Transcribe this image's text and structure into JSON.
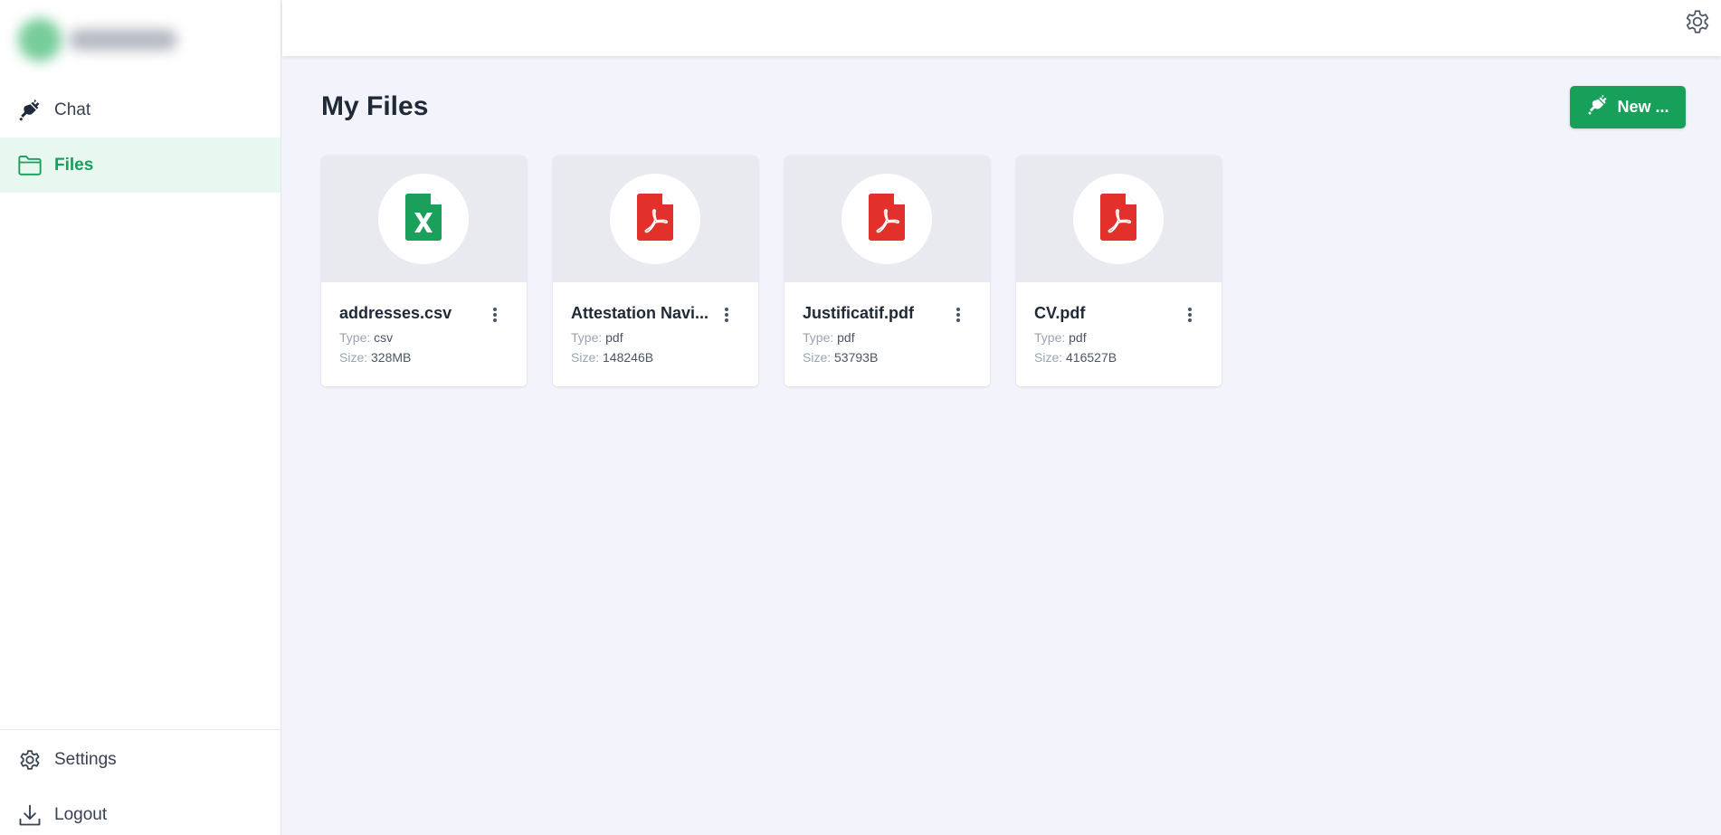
{
  "sidebar": {
    "nav": [
      {
        "label": "Chat",
        "icon": "plug-icon"
      },
      {
        "label": "Files",
        "icon": "folder-icon",
        "active": true
      }
    ],
    "bottom": [
      {
        "label": "Settings",
        "icon": "gear-icon"
      },
      {
        "label": "Logout",
        "icon": "download-icon"
      }
    ]
  },
  "topbar": {
    "icon": "gear-icon"
  },
  "main": {
    "title": "My Files",
    "new_button": {
      "label": "New ...",
      "icon": "plug-icon"
    },
    "type_key": "Type:",
    "size_key": "Size:",
    "files": [
      {
        "name": "addresses.csv",
        "type": "csv",
        "size": "328MB",
        "icon": "excel-file-icon"
      },
      {
        "name": "Attestation Navi...",
        "type": "pdf",
        "size": "148246B",
        "icon": "pdf-file-icon"
      },
      {
        "name": "Justificatif.pdf",
        "type": "pdf",
        "size": "53793B",
        "icon": "pdf-file-icon"
      },
      {
        "name": "CV.pdf",
        "type": "pdf",
        "size": "416527B",
        "icon": "pdf-file-icon"
      }
    ]
  },
  "colors": {
    "accent": "#16a05a",
    "excel": "#1aa05a",
    "pdf": "#e2302b",
    "background": "#f3f4fb"
  }
}
